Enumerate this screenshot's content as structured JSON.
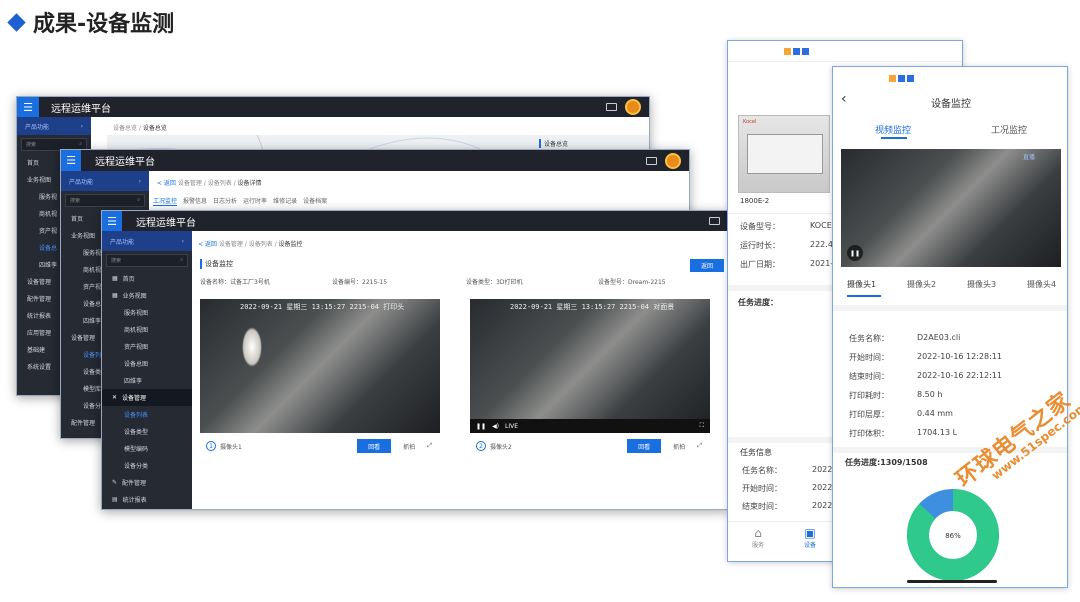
{
  "slide": {
    "title": "成果-设备监测"
  },
  "app": {
    "name": "远程运维平台",
    "menu_icon": "☰",
    "product_menu": "产品功能",
    "search_placeholder": "搜索"
  },
  "win1": {
    "breadcrumb_pre": "设备总览 / ",
    "breadcrumb_cur": "设备总览",
    "map_label": "设备总览",
    "side": [
      "首页",
      "业务视图",
      "服务视",
      "商机视",
      "资产视",
      "设备总",
      "四维孪",
      "设备管理",
      "配件管理",
      "统计报表",
      "应用管理",
      "基础建",
      "系统设置"
    ]
  },
  "win2": {
    "breadcrumb_back": "< 返回",
    "breadcrumb_path": "设备管理 / 设备列表 / ",
    "breadcrumb_cur": "设备详情",
    "tabs": [
      "工况监控",
      "报警信息",
      "日志分析",
      "运行时率",
      "维修记录",
      "设备档案"
    ],
    "side": [
      "首页",
      "业务视图",
      "服务视",
      "商机视",
      "资产视",
      "设备总",
      "四维孪",
      "设备管理",
      "设备列",
      "设备类",
      "模型库",
      "设备分",
      "配件管理"
    ]
  },
  "win3": {
    "breadcrumb_back": "< 返回",
    "breadcrumb_path": "设备管理 / 设备列表 / ",
    "breadcrumb_cur": "设备监控",
    "page_title": "设备监控",
    "top_button": "返回",
    "info": {
      "location": "设备名称：试备工厂3号机",
      "serial": "设备编号：2215-15",
      "type": "设备类型：3D打印机",
      "model": "设备型号：Dream-2215"
    },
    "side": {
      "home": "首页",
      "business": "业务视图",
      "sub_business": [
        "服务视图",
        "商机视图",
        "资产视图",
        "设备总图",
        "四维孪"
      ],
      "device_mgmt": "设备管理",
      "sub_device": [
        "设备列表",
        "设备类型",
        "模型编码",
        "设备分类"
      ],
      "parts": "配件管理",
      "stats": "统计报表"
    },
    "cams": [
      {
        "timestamp": "2022-09-21 星期三 13:15:27  2215-04  打印头",
        "num": "1",
        "label": "摄像头1",
        "btn1": "回看",
        "btn2": "抓拍"
      },
      {
        "timestamp": "2022-09-21 星期三 13:15:27  2215-04  对面景",
        "num": "2",
        "label": "摄像头2",
        "btn1": "回看",
        "btn2": "抓拍",
        "live": "LIVE"
      }
    ]
  },
  "phone1": {
    "machine_caption": "1800E-2",
    "machine_brand": "Kocel",
    "rows": [
      {
        "k": "设备型号：",
        "v": "KOCE"
      },
      {
        "k": "运行时长：",
        "v": "222.4"
      },
      {
        "k": "出厂日期：",
        "v": "2021-"
      }
    ],
    "progress_title": "任务进度：",
    "task_title": "任务信息",
    "task_rows": [
      {
        "k": "任务名称：",
        "v": "2022"
      },
      {
        "k": "开始时间：",
        "v": "2022"
      },
      {
        "k": "结束时间：",
        "v": "2022"
      }
    ],
    "nav": [
      "服务",
      "设备"
    ]
  },
  "phone2": {
    "title": "设备监控",
    "tabs": [
      "视频监控",
      "工况监控"
    ],
    "video_badge": "直播",
    "cam_tabs": [
      "摄像头1",
      "摄像头2",
      "摄像头3",
      "摄像头4"
    ],
    "rows": [
      {
        "k": "任务名称：",
        "v": "D2AE03.cli"
      },
      {
        "k": "开始时间：",
        "v": "2022-10-16 12:28:11"
      },
      {
        "k": "结束时间：",
        "v": "2022-10-16 22:12:11"
      },
      {
        "k": "打印耗时：",
        "v": "8.50 h"
      },
      {
        "k": "打印层厚：",
        "v": "0.44 mm"
      },
      {
        "k": "打印体积：",
        "v": "1704.13 L"
      }
    ],
    "progress_label": "任务进度:1309/1508",
    "progress_pct": "86%",
    "progress_fraction": 0.868
  },
  "watermark": {
    "line1": "环球电气之家",
    "line2": "www.51spec.com"
  },
  "colors": {
    "accent": "#1a6fe0",
    "topbar": "#20232b",
    "sidebar": "#252a33",
    "ring_blue": "#3f8fe0",
    "ring_green": "#2ec98b"
  }
}
